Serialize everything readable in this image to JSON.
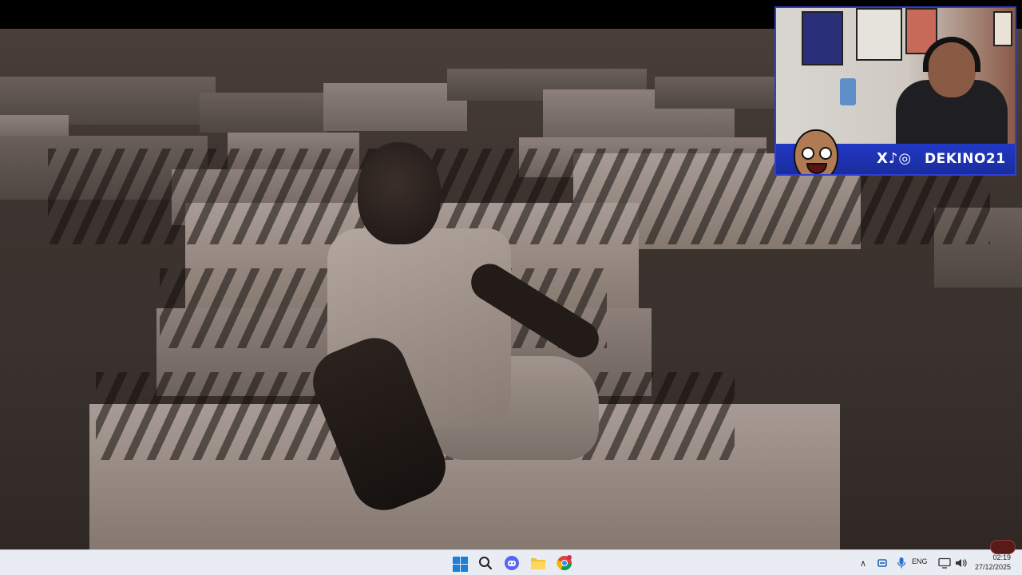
{
  "overlay": {
    "social_icons": "X♪◎",
    "handle": "DEKINO21"
  },
  "taskbar": {
    "icons": [
      "windows-start-icon",
      "search-icon",
      "discord-icon",
      "file-explorer-icon",
      "chrome-icon"
    ],
    "language": "ENG",
    "time": "02:19",
    "date": "27/12/2025"
  },
  "colors": {
    "banner": "#1a2c9c",
    "taskbar": "#e9edf3",
    "start_accent": "#1a7fd9"
  }
}
